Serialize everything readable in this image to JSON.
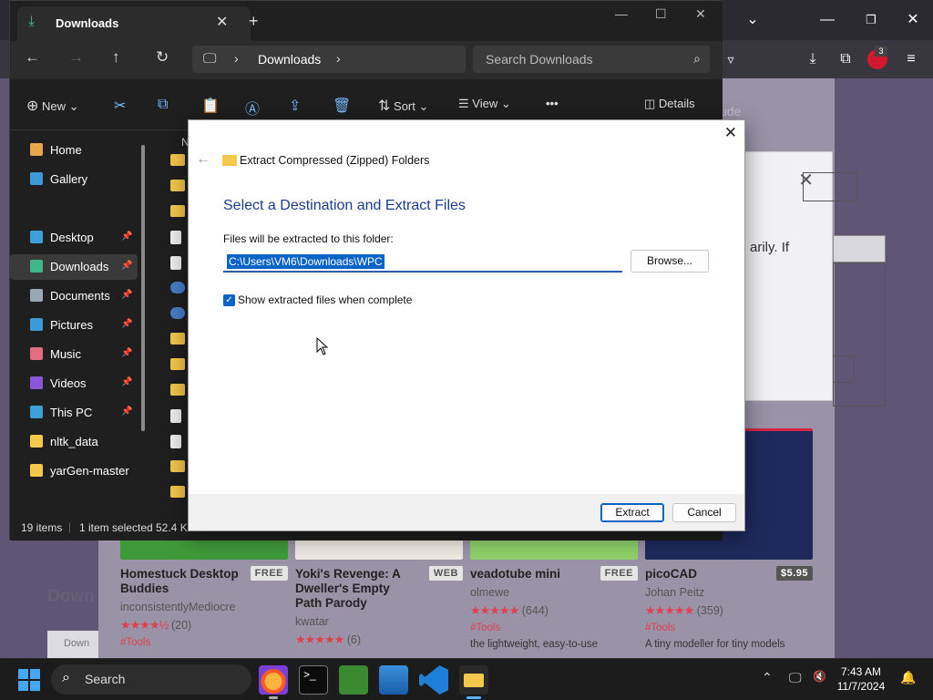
{
  "explorer": {
    "tab_title": "Downloads",
    "address_path": "Downloads",
    "search_placeholder": "Search Downloads",
    "cmd": {
      "new": "New",
      "sort": "Sort",
      "view": "View",
      "details": "Details"
    },
    "nav_items": [
      {
        "label": "Home",
        "icon": "home-icon",
        "color": "#e8a64a"
      },
      {
        "label": "Gallery",
        "icon": "gallery-icon",
        "color": "#3d9ad9"
      },
      {
        "label": "Desktop",
        "icon": "desktop-icon",
        "color": "#3fa0d8",
        "pinned": true
      },
      {
        "label": "Downloads",
        "icon": "download-icon",
        "color": "#3fb68b",
        "pinned": true,
        "selected": true
      },
      {
        "label": "Documents",
        "icon": "documents-icon",
        "color": "#9aa7b5",
        "pinned": true
      },
      {
        "label": "Pictures",
        "icon": "pictures-icon",
        "color": "#3d9ad9",
        "pinned": true
      },
      {
        "label": "Music",
        "icon": "music-icon",
        "color": "#e26d7e",
        "pinned": true
      },
      {
        "label": "Videos",
        "icon": "videos-icon",
        "color": "#8a56d6",
        "pinned": true
      },
      {
        "label": "This PC",
        "icon": "pc-icon",
        "color": "#3fa0d8",
        "pinned": true
      },
      {
        "label": "nltk_data",
        "icon": "folder-icon",
        "color": "#f4c84a"
      },
      {
        "label": "yarGen-master",
        "icon": "folder-icon",
        "color": "#f4c84a"
      }
    ],
    "file_col_header": "N",
    "status": {
      "count": "19 items",
      "selected": "1 item selected",
      "size": "52.4 KB"
    }
  },
  "dialog": {
    "title": "Extract Compressed (Zipped) Folders",
    "heading": "Select a Destination and Extract Files",
    "path_label": "Files will be extracted to this folder:",
    "path_value": "C:\\Users\\VM6\\Downloads\\WPC",
    "browse_label": "Browse...",
    "checkbox_label": "Show extracted files when complete",
    "checkbox_checked": true,
    "extract_label": "Extract",
    "cancel_label": "Cancel"
  },
  "browser": {
    "badge_count": "3",
    "popup_text": "arily. If",
    "ghost_text": "ude",
    "section_label": "Down",
    "button_label": "Down",
    "cards": [
      {
        "title": "Homestuck Desktop Buddies",
        "price": "FREE",
        "author": "inconsistentlyMediocre",
        "stars": "★★★★½",
        "reviews": "(20)",
        "tag": "#Tools",
        "desc": ""
      },
      {
        "title": "Yoki's Revenge: A Dweller's Empty Path Parody",
        "price": "WEB",
        "author": "kwatar",
        "stars": "★★★★★",
        "reviews": "(6)",
        "tag": "",
        "desc": ""
      },
      {
        "title": "veadotube mini",
        "price": "FREE",
        "author": "olmewe",
        "stars": "★★★★★",
        "reviews": "(644)",
        "tag": "#Tools",
        "desc": "the lightweight, easy-to-use"
      },
      {
        "title": "picoCAD",
        "price": "$5.95",
        "author": "Johan Peitz",
        "stars": "★★★★★",
        "reviews": "(359)",
        "tag": "#Tools",
        "desc": "A tiny modeller for tiny models"
      }
    ]
  },
  "taskbar": {
    "search_label": "Search",
    "time": "7:43 AM",
    "date": "11/7/2024"
  }
}
